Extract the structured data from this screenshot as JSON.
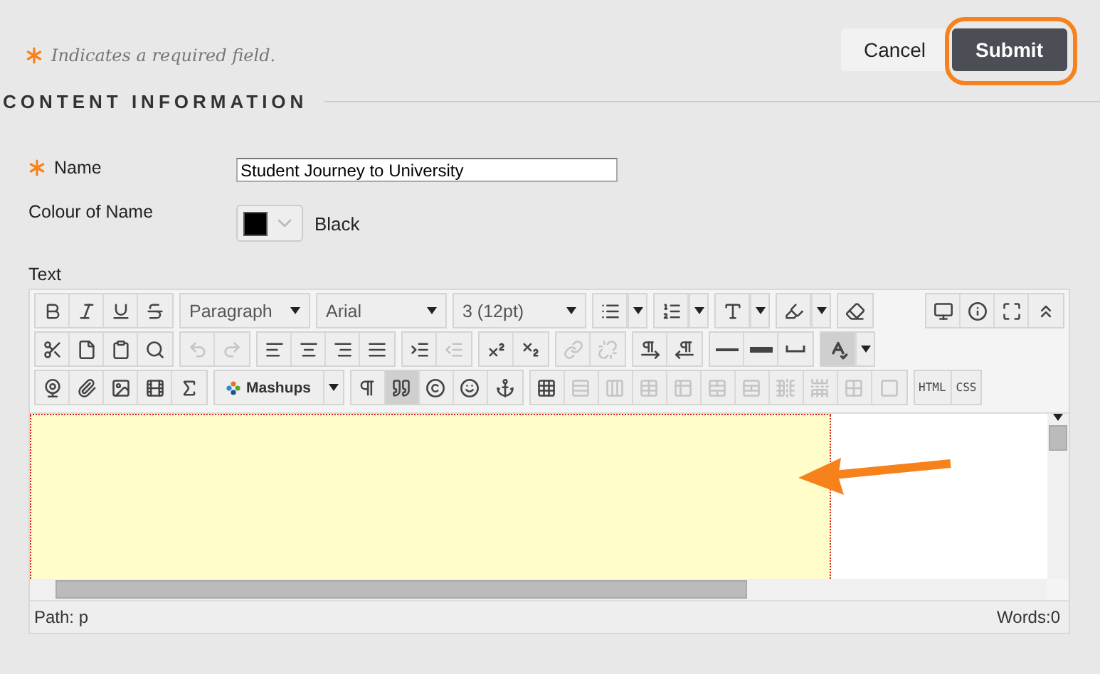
{
  "header": {
    "required_note": "Indicates a required field.",
    "buttons": [
      {
        "kind": "secondary",
        "label": "Cancel"
      },
      {
        "kind": "primary",
        "label": "Submit",
        "highlighted": true
      }
    ]
  },
  "section": {
    "title": "CONTENT INFORMATION"
  },
  "fields": [
    {
      "kind": "text",
      "label": "Name",
      "required": true,
      "value": "Student Journey to University"
    },
    {
      "kind": "color",
      "label": "Colour of Name",
      "required": false,
      "value": "Black"
    }
  ],
  "editor": {
    "label": "Text",
    "toolbar": {
      "rows": [
        {
          "groups": [
            {
              "items": [
                {
                  "kind": "button",
                  "disabled": false
                },
                {
                  "kind": "button",
                  "disabled": false
                },
                {
                  "kind": "button",
                  "disabled": false
                },
                {
                  "kind": "button",
                  "disabled": false
                }
              ]
            },
            {
              "items": [
                {
                  "kind": "select",
                  "value": "Paragraph"
                }
              ]
            },
            {
              "items": [
                {
                  "kind": "select",
                  "value": "Arial"
                }
              ]
            },
            {
              "items": [
                {
                  "kind": "select",
                  "value": "3 (12pt)"
                }
              ]
            },
            {
              "items": [
                {
                  "kind": "split",
                  "disabled": false
                }
              ]
            },
            {
              "items": [
                {
                  "kind": "split",
                  "disabled": false
                }
              ]
            },
            {
              "items": [
                {
                  "kind": "split",
                  "disabled": false
                }
              ]
            },
            {
              "items": [
                {
                  "kind": "split",
                  "disabled": false
                }
              ]
            },
            {
              "items": [
                {
                  "kind": "button",
                  "disabled": false
                }
              ]
            }
          ],
          "end_groups": [
            {
              "items": [
                {
                  "kind": "button",
                  "disabled": false
                },
                {
                  "kind": "button",
                  "disabled": false
                },
                {
                  "kind": "button",
                  "disabled": false
                },
                {
                  "kind": "button",
                  "disabled": false
                }
              ]
            }
          ]
        },
        {
          "groups": [
            {
              "items": [
                {
                  "kind": "button",
                  "disabled": false
                },
                {
                  "kind": "button",
                  "disabled": false
                },
                {
                  "kind": "button",
                  "disabled": false
                },
                {
                  "kind": "button",
                  "disabled": false
                }
              ]
            },
            {
              "items": [
                {
                  "kind": "button",
                  "disabled": true
                },
                {
                  "kind": "button",
                  "disabled": true
                }
              ]
            },
            {
              "items": [
                {
                  "kind": "button",
                  "disabled": false
                },
                {
                  "kind": "button",
                  "disabled": false
                },
                {
                  "kind": "button",
                  "disabled": false
                },
                {
                  "kind": "button",
                  "disabled": false
                }
              ]
            },
            {
              "items": [
                {
                  "kind": "button",
                  "disabled": false
                },
                {
                  "kind": "button",
                  "disabled": true
                }
              ]
            },
            {
              "items": [
                {
                  "kind": "button",
                  "disabled": false
                },
                {
                  "kind": "button",
                  "disabled": false
                }
              ]
            },
            {
              "items": [
                {
                  "kind": "button",
                  "disabled": true
                },
                {
                  "kind": "button",
                  "disabled": true
                }
              ]
            },
            {
              "items": [
                {
                  "kind": "button",
                  "disabled": false
                },
                {
                  "kind": "button",
                  "disabled": false
                }
              ]
            },
            {
              "items": [
                {
                  "kind": "button",
                  "disabled": false
                },
                {
                  "kind": "button",
                  "disabled": false
                },
                {
                  "kind": "button",
                  "disabled": false
                }
              ]
            },
            {
              "items": [
                {
                  "kind": "split",
                  "disabled": false,
                  "pressed": true
                }
              ]
            }
          ]
        },
        {
          "groups": [
            {
              "items": [
                {
                  "kind": "button",
                  "disabled": false
                },
                {
                  "kind": "button",
                  "disabled": false
                },
                {
                  "kind": "button",
                  "disabled": false
                },
                {
                  "kind": "button",
                  "disabled": false
                },
                {
                  "kind": "button",
                  "disabled": false
                }
              ]
            },
            {
              "items": [
                {
                  "kind": "menu",
                  "label": "Mashups"
                }
              ]
            },
            {
              "items": [
                {
                  "kind": "button",
                  "disabled": false
                },
                {
                  "kind": "button",
                  "disabled": false,
                  "pressed": true
                },
                {
                  "kind": "button",
                  "disabled": false
                },
                {
                  "kind": "button",
                  "disabled": false
                },
                {
                  "kind": "button",
                  "disabled": false
                }
              ]
            },
            {
              "items": [
                {
                  "kind": "button",
                  "disabled": false
                },
                {
                  "kind": "button",
                  "disabled": true
                },
                {
                  "kind": "button",
                  "disabled": true
                },
                {
                  "kind": "button",
                  "disabled": true
                },
                {
                  "kind": "button",
                  "disabled": true
                },
                {
                  "kind": "button",
                  "disabled": true
                },
                {
                  "kind": "button",
                  "disabled": true
                },
                {
                  "kind": "button",
                  "disabled": true
                },
                {
                  "kind": "button",
                  "disabled": true
                },
                {
                  "kind": "button",
                  "disabled": true
                },
                {
                  "kind": "button",
                  "disabled": true
                }
              ]
            },
            {
              "items": [
                {
                  "kind": "text",
                  "label": "HTML"
                },
                {
                  "kind": "text",
                  "label": "CSS"
                }
              ]
            }
          ]
        }
      ]
    },
    "status": {
      "path_label": "Path:",
      "path": "p",
      "words": "Words:0"
    }
  }
}
